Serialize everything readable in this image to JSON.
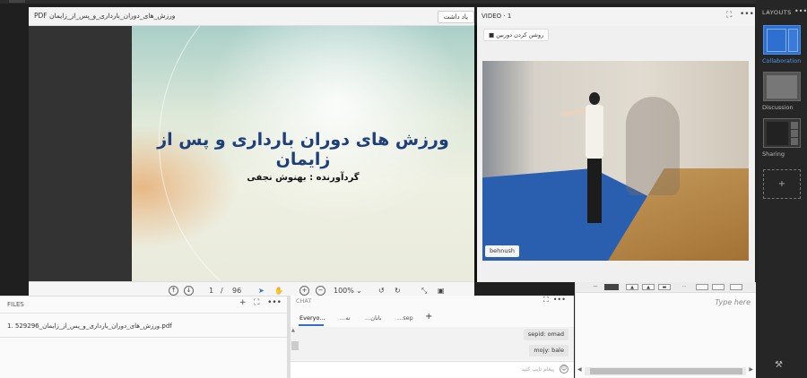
{
  "pdf": {
    "title": "PDF ورزش_های_دوران_بارداری_و_پس_از_زایمان",
    "annotate_label": "یاد داشت",
    "slide_title": "ورزش های دوران بارداری و پس از زایمان",
    "slide_subtitle": "گردآورنده : بهنوش نجفی",
    "toolbar": {
      "page_current": "1",
      "page_sep": "/",
      "page_total": "96",
      "zoom": "100%"
    }
  },
  "video": {
    "title": "VIDEO · 1",
    "camera_button": "روشن کردن دوربین",
    "participant_name": "behnush"
  },
  "layouts": {
    "title": "LAYOUTS",
    "items": [
      {
        "label": "Collaboration",
        "active": true
      },
      {
        "label": "Discussion",
        "active": false
      },
      {
        "label": "Sharing",
        "active": false
      }
    ],
    "add_label": "+"
  },
  "files": {
    "title": "FILES",
    "items": [
      "1. 529296_ورزش_های_دوران_بارداری_و_پس_از_زایمان.pdf"
    ]
  },
  "chat": {
    "title": "CHAT",
    "tabs": [
      "Everyo...",
      "...ته",
      "...باتان",
      "...sep"
    ],
    "add_tab_label": "+",
    "messages": [
      {
        "sender": "sepid",
        "text": "omad"
      },
      {
        "sender": "mojy",
        "text": "bale"
      }
    ],
    "message_1": "sepid: omad",
    "message_2": "mojy: bale",
    "input_placeholder": "پیغام تایپ کنید"
  },
  "notes": {
    "placeholder": "Type here"
  },
  "colors": {
    "accent": "#2f6fcf",
    "slide_title": "#1f3f7a",
    "sidebar_bg": "#262626"
  }
}
